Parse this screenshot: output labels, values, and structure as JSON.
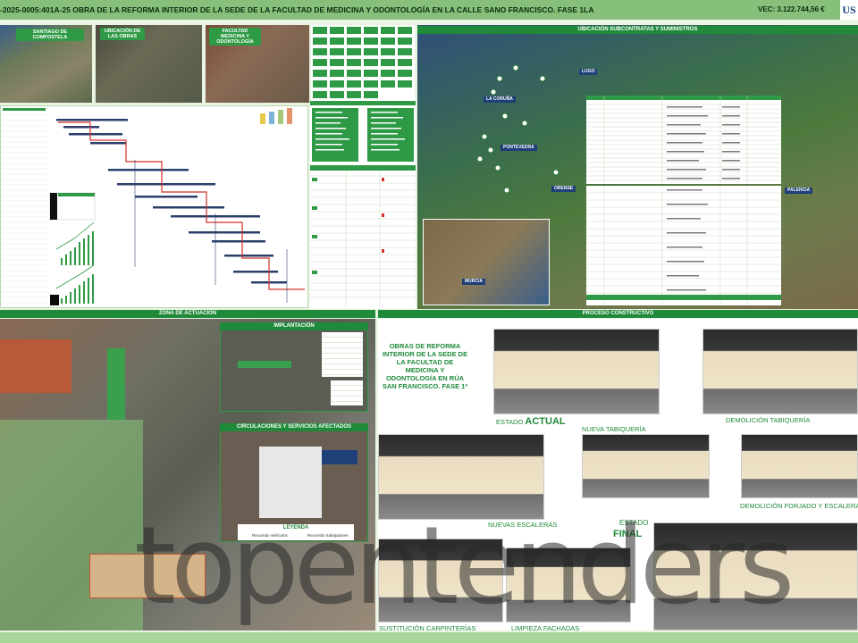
{
  "header": {
    "title": "-2025-0005:401A-25 OBRA DE LA REFORMA INTERIOR DE LA SEDE DE LA FACULTAD DE MEDICINA Y ODONTOLOGÍA EN LA CALLE SANO FRANCISCO. FASE 1LA",
    "pec": "VEC: 3.122.744,56 €",
    "logo": "US"
  },
  "photos": [
    {
      "label": "SANTIAGO DE COMPOSTELA"
    },
    {
      "label": "UBICACIÓN DE LAS OBRAS"
    },
    {
      "label": "FACULTAD MEDICINA Y ODONTOLOGÍA"
    }
  ],
  "map": {
    "title": "UBICACIÓN SUBCONTRATAS Y SUMINISTROS",
    "regions": [
      "LUGO",
      "LA CORUÑA",
      "PONTEVEDRA",
      "ORENSE",
      "PALENCIA",
      "MURCIA"
    ]
  },
  "zone": {
    "title": "ZONA DE ACTUACIÓN",
    "implantation_title": "IMPLANTACIÓN",
    "circulations_title": "CIRCULACIONES Y SERVICIOS AFECTADOS",
    "legend_title": "LEYENDA",
    "legend_items": [
      "Recorrido vehículos",
      "Recorrido trabajadores"
    ]
  },
  "process": {
    "title": "PROCESO CONSTRUCTIVO",
    "project_name": "OBRAS DE REFORMA INTERIOR DE LA SEDE DE LA FACULTAD DE MEDICINA Y ODONTOLOGÍA EN RÚA SAN FRANCISCO. FASE 1ª",
    "state_label": "ESTADO",
    "actual": "ACTUAL",
    "final": "FINAL",
    "steps": [
      "NUEVA TABIQUERÍA",
      "DEMOLICIÓN TABIQUERÍA",
      "NUEVAS ESCALERAS",
      "DEMOLICIÓN FORJADO Y ESCALERA",
      "SUSTITUCIÓN CARPINTERÍAS",
      "LIMPIEZA FACHADAS"
    ]
  },
  "watermark": "topentenders",
  "colors": {
    "accent": "#1f8a3a",
    "header": "#86c07a",
    "critical": "#d0302a",
    "bar": "#2b3f6b"
  }
}
